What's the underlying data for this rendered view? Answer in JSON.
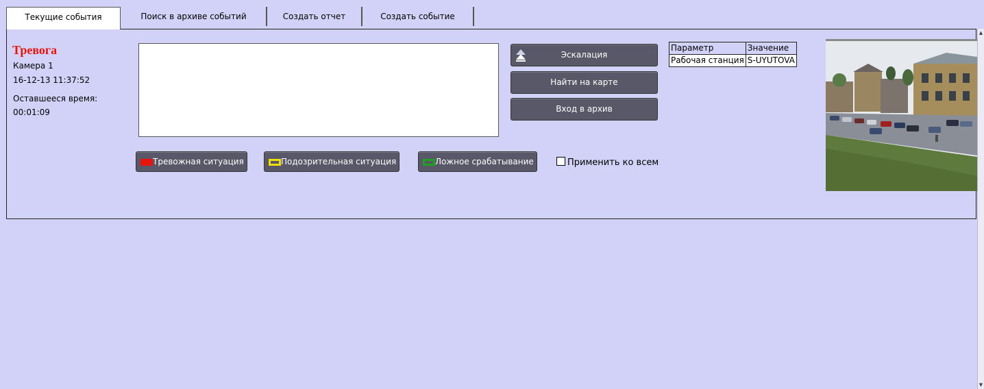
{
  "tabs": [
    {
      "label": "Текущие события",
      "active": true
    },
    {
      "label": "Поиск в архиве событий",
      "active": false
    },
    {
      "label": "Создать отчет",
      "active": false
    },
    {
      "label": "Создать событие",
      "active": false
    }
  ],
  "event": {
    "title": "Тревога",
    "camera": "Камера 1",
    "datetime": "16-12-13 11:37:52",
    "remaining_label": "Оставшееся время:",
    "remaining_time": "00:01:09",
    "comment": ""
  },
  "actions": {
    "escalation": "Эскалация",
    "find_on_map": "Найти на карте",
    "archive": "Вход в архив"
  },
  "categories": {
    "alarm": "Тревожная ситуация",
    "suspicious": "Подозрительная ситуация",
    "false_alarm": "Ложное срабатывание",
    "apply_all": "Применить ко всем",
    "apply_all_checked": false
  },
  "params_table": {
    "headers": [
      "Параметр",
      "Значение"
    ],
    "rows": [
      [
        "Рабочая станция",
        "S-UYUTOVA"
      ]
    ]
  },
  "colors": {
    "alarm_title": "#e8140c",
    "alarm_swatch": "#e8140c",
    "suspicious_swatch": "#f0e000",
    "false_swatch": "#1ea020",
    "background": "#d2d2f8"
  },
  "icons": {
    "escalation": "double-chevron-up-icon",
    "camera": "camera-snapshot"
  }
}
